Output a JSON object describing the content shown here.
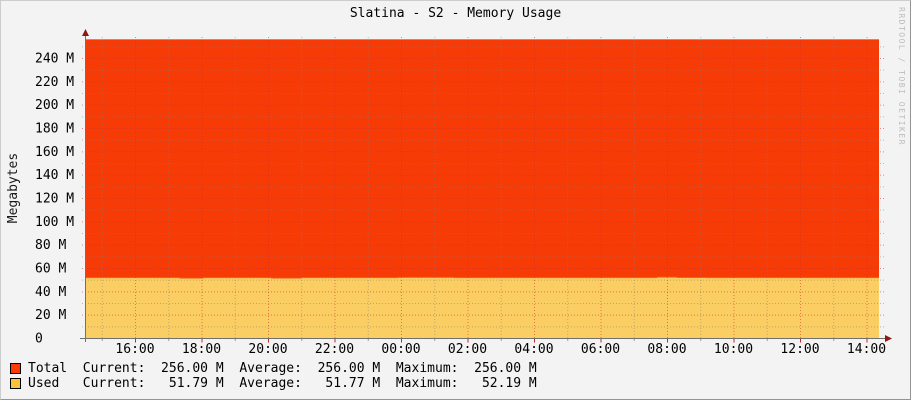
{
  "watermark": "RRDTOOL / TOBI OETIKER",
  "colors": {
    "background": "#f3f3f3",
    "total_area": "#f73b07",
    "used_area": "#fbce63",
    "used_line": "#e0641e",
    "legend_total_swatch": "#f93d00",
    "legend_used_swatch": "#fac33c",
    "axis": "#707070",
    "arrow": "#8f1714",
    "grid_major": "rgba(205,45,45,0.55)",
    "grid_minor": "rgba(125,125,125,0.5)"
  },
  "chart_data": {
    "type": "area",
    "title": "Slatina - S2 - Memory Usage",
    "ylabel": "Megabytes",
    "xlabel": "",
    "ylim": [
      0,
      257
    ],
    "x_range_hours": [
      14.51,
      38.37
    ],
    "grid": "dotted, minor every 10M / 1h, major every 20M / 2h",
    "legend_position": "bottom-left",
    "y_ticks": [
      {
        "v": 0,
        "t": "  0"
      },
      {
        "v": 20,
        "t": " 20 M"
      },
      {
        "v": 40,
        "t": " 40 M"
      },
      {
        "v": 60,
        "t": " 60 M"
      },
      {
        "v": 80,
        "t": " 80 M"
      },
      {
        "v": 100,
        "t": "100 M"
      },
      {
        "v": 120,
        "t": "120 M"
      },
      {
        "v": 140,
        "t": "140 M"
      },
      {
        "v": 160,
        "t": "160 M"
      },
      {
        "v": 180,
        "t": "180 M"
      },
      {
        "v": 200,
        "t": "200 M"
      },
      {
        "v": 220,
        "t": "220 M"
      },
      {
        "v": 240,
        "t": "240 M"
      }
    ],
    "x_ticks": [
      {
        "h": 16,
        "t": "16:00"
      },
      {
        "h": 18,
        "t": "18:00"
      },
      {
        "h": 20,
        "t": "20:00"
      },
      {
        "h": 22,
        "t": "22:00"
      },
      {
        "h": 24,
        "t": "00:00"
      },
      {
        "h": 26,
        "t": "02:00"
      },
      {
        "h": 28,
        "t": "04:00"
      },
      {
        "h": 30,
        "t": "06:00"
      },
      {
        "h": 32,
        "t": "08:00"
      },
      {
        "h": 34,
        "t": "10:00"
      },
      {
        "h": 36,
        "t": "12:00"
      },
      {
        "h": 38,
        "t": "14:00"
      }
    ],
    "series": [
      {
        "name": "Total",
        "style": "area",
        "constant_value": 256
      },
      {
        "name": "Used",
        "style": "area+line",
        "points": [
          {
            "t": 14.51,
            "v": 51.8
          },
          {
            "t": 17.35,
            "v": 51.3
          },
          {
            "t": 18.05,
            "v": 51.8
          },
          {
            "t": 20.1,
            "v": 51.3
          },
          {
            "t": 21.0,
            "v": 51.8
          },
          {
            "t": 23.9,
            "v": 51.95
          },
          {
            "t": 25.6,
            "v": 51.8
          },
          {
            "t": 31.7,
            "v": 52.19
          },
          {
            "t": 32.3,
            "v": 51.9
          },
          {
            "t": 33.2,
            "v": 51.79
          },
          {
            "t": 38.37,
            "v": 51.79
          }
        ]
      }
    ],
    "legend": {
      "stat_labels": [
        "Current:",
        "Average:",
        "Maximum:"
      ],
      "rows": [
        {
          "label": "Total",
          "current": "256.00 M",
          "average": "256.00 M",
          "maximum": "256.00 M"
        },
        {
          "label": "Used",
          "current": "51.79 M",
          "average": "51.77 M",
          "maximum": "52.19 M"
        }
      ]
    }
  }
}
